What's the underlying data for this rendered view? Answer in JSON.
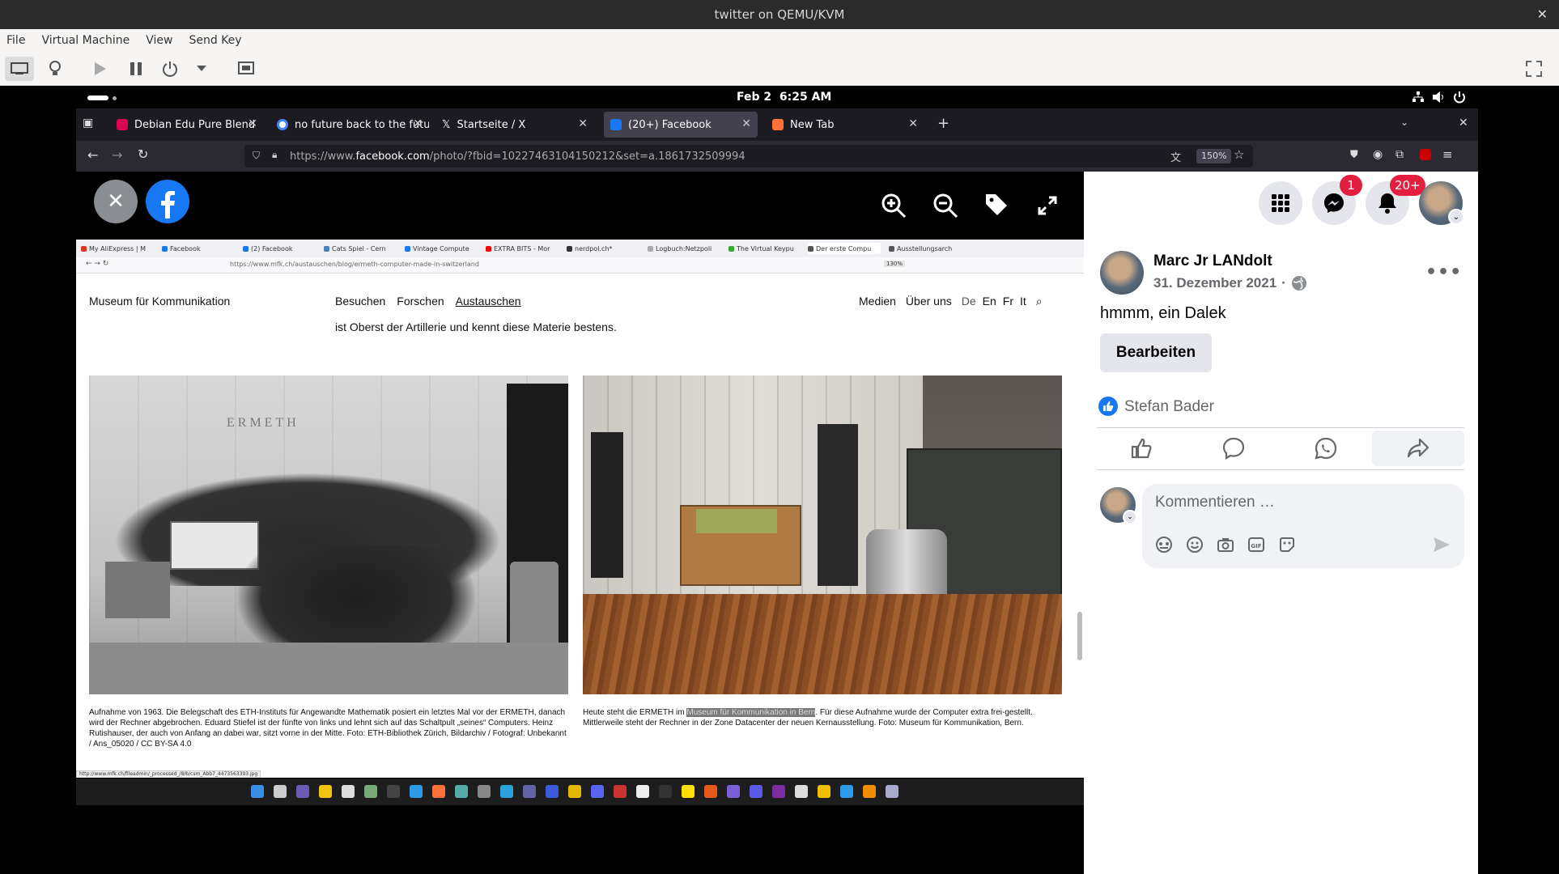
{
  "qemu": {
    "title": "twitter on QEMU/KVM",
    "menu": [
      "File",
      "Virtual Machine",
      "View",
      "Send Key"
    ]
  },
  "gnome": {
    "date": "Feb 2",
    "time": "6:25 AM"
  },
  "firefox": {
    "tabs": [
      {
        "label": "Debian Edu Pure Blend",
        "color": "#d70751"
      },
      {
        "label": "no future back to the futu",
        "color": "#4285f4"
      },
      {
        "label": "Startseite / X",
        "color": "#000000"
      },
      {
        "label": "(20+) Facebook",
        "color": "#1877f2"
      },
      {
        "label": "New Tab",
        "color": "#ff7139"
      }
    ],
    "url_prefix": "https://www.",
    "url_domain": "facebook.com",
    "url_path": "/photo/?fbid=10227463104150212&set=a.1861732509994",
    "zoom": "150%"
  },
  "fb": {
    "messenger_badge": "1",
    "notif_badge": "20+",
    "author": "Marc Jr LANdolt",
    "date": "31. Dezember 2021",
    "post_text": "hmmm, ein Dalek",
    "edit_button": "Bearbeiten",
    "liker": "Stefan Bader",
    "comment_placeholder": "Kommentieren …"
  },
  "inner": {
    "tabs": [
      "My AliExpress | M",
      "Facebook",
      "(2) Facebook",
      "Cats Spiel - Cern",
      "Vintage Compute",
      "EXTRA BITS - Mor",
      "nerdpol.ch*",
      "Logbuch:Netzpoli",
      "The Virtual Keypu",
      "Der erste Compu",
      "Ausstellungsarch"
    ],
    "url": "https://www.mfk.ch/austauschen/blog/ermeth-computer-made-in-switzerland",
    "zoom": "130%",
    "site_title": "Museum für Kommunikation",
    "nav": [
      "Besuchen",
      "Forschen",
      "Austauschen"
    ],
    "nav_right": [
      "Medien",
      "Über uns"
    ],
    "langs": [
      "De",
      "En",
      "Fr",
      "It"
    ],
    "intro": "ist Oberst der Artillerie und kennt diese Materie bestens.",
    "caption_left": "Aufnahme von 1963. Die Belegschaft des ETH-Instituts für Angewandte Mathematik posiert ein letztes Mal vor der ERMETH, danach wird der Rechner abgebrochen. Eduard Stiefel ist der fünfte von links und lehnt sich auf das Schaltpult „seines“ Computers. Heinz Rutishauser, der auch von Anfang an dabei war, sitzt vorne in der Mitte. Foto: ETH-Bibliothek Zürich, Bildarchiv / Fotograf: Unbekannt / Ans_05020 / CC BY-SA 4.0",
    "caption_right_a": "Heute steht die ERMETH im ",
    "caption_right_hl": "Museum für Kommunikation in Bern",
    "caption_right_b": ". Für diese Aufnahme wurde der Computer extra frei-gestellt. Mittlerweile steht der Rechner in der Zone Datacenter der neuen Kernausstellung. Foto: Museum für Kommunikation, Bern.",
    "status_url": "http://www.mfk.ch/fileadmin/_processed_/8/b/csm_Abb7_4473563393.jpg",
    "photo_label": "ERMETH"
  }
}
